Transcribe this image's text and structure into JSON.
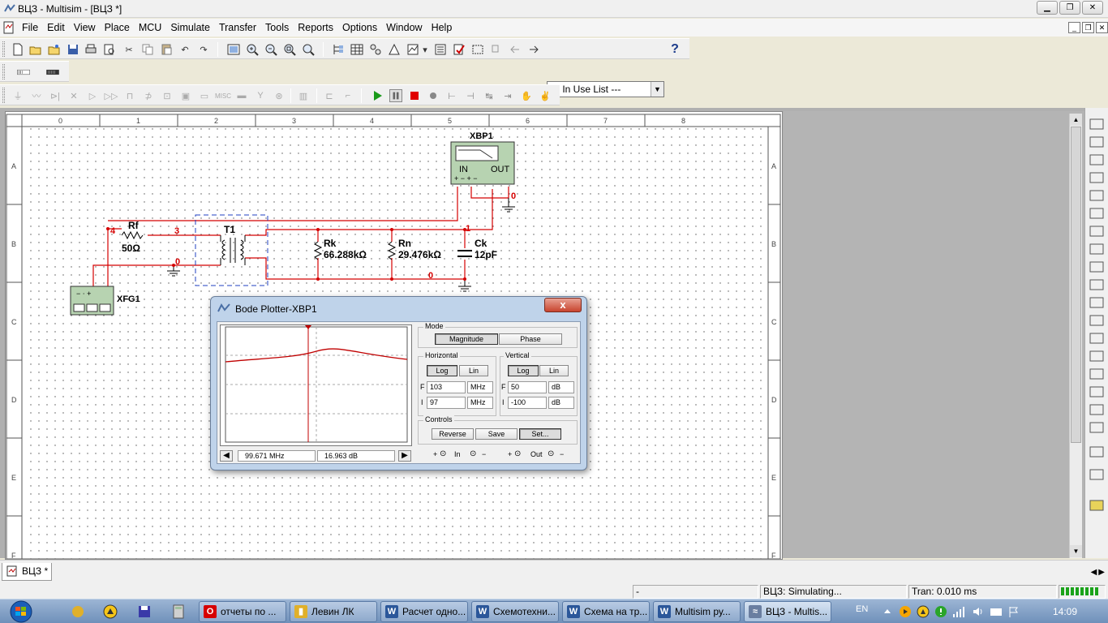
{
  "window": {
    "title": "ВЦЗ - Multisim - [ВЦЗ *]"
  },
  "menu": {
    "items": [
      "File",
      "Edit",
      "View",
      "Place",
      "MCU",
      "Simulate",
      "Transfer",
      "Tools",
      "Reports",
      "Options",
      "Window",
      "Help"
    ]
  },
  "toolbar": {
    "in_use_list": "--- In Use List ---",
    "help_glyph": "?"
  },
  "ruler": {
    "columns": [
      "0",
      "1",
      "2",
      "3",
      "4",
      "5",
      "6",
      "7",
      "8"
    ],
    "rows": [
      "A",
      "B",
      "C",
      "D",
      "E",
      "F"
    ]
  },
  "schematic": {
    "xbp1_label": "XBP1",
    "xbp1_in": "IN",
    "xbp1_out": "OUT",
    "xbp1_pins": "+ − + −",
    "rf_label": "Rf",
    "rf_value": "50Ω",
    "t1_label": "T1",
    "rk_label": "Rk",
    "rk_value": "66.288kΩ",
    "rn_label": "Rn",
    "rn_value": "29.476kΩ",
    "ck_label": "Ck",
    "ck_value": "12pF",
    "xfg1_label": "XFG1",
    "xfg1_pins": "− ⋅ +",
    "net4": "4",
    "net3": "3",
    "net1": "1",
    "net0_a": "0",
    "net0_b": "0",
    "net0_c": "0"
  },
  "bode": {
    "title": "Bode Plotter-XBP1",
    "close_glyph": "x",
    "mode_label": "Mode",
    "magnitude": "Magnitude",
    "phase": "Phase",
    "horizontal_label": "Horizontal",
    "vertical_label": "Vertical",
    "log": "Log",
    "lin": "Lin",
    "f_label": "F",
    "i_label": "I",
    "h_f_value": "103",
    "h_f_unit": "MHz",
    "h_i_value": "97",
    "h_i_unit": "MHz",
    "v_f_value": "50",
    "v_f_unit": "dB",
    "v_i_value": "-100",
    "v_i_unit": "dB",
    "controls_label": "Controls",
    "reverse": "Reverse",
    "save": "Save",
    "set": "Set...",
    "readout_freq": "99.671 MHz",
    "readout_gain": "16.963 dB",
    "in_label": "In",
    "out_label": "Out",
    "plus": "+",
    "minus": "−",
    "trace_color": "#c00000"
  },
  "tab": {
    "label": "ВЦЗ *"
  },
  "status": {
    "cell1": "-",
    "cell2": "ВЦЗ: Simulating...",
    "cell3": "Tran: 0.010 ms"
  },
  "taskbar": {
    "tasks": [
      {
        "label": "отчеты по ...",
        "color": "#d60000",
        "glyph": "O"
      },
      {
        "label": "Левин ЛК",
        "color": "#e0b02a",
        "glyph": "▮"
      },
      {
        "label": "Расчет одно...",
        "color": "#2b579a",
        "glyph": "W"
      },
      {
        "label": "Схемотехни...",
        "color": "#2b579a",
        "glyph": "W"
      },
      {
        "label": "Схема на тр...",
        "color": "#2b579a",
        "glyph": "W"
      },
      {
        "label": "Multisim ру...",
        "color": "#2b579a",
        "glyph": "W"
      },
      {
        "label": "ВЦЗ - Multis...",
        "color": "#6a7ea0",
        "glyph": "≈"
      }
    ],
    "lang": "EN",
    "clock": "14:09"
  }
}
